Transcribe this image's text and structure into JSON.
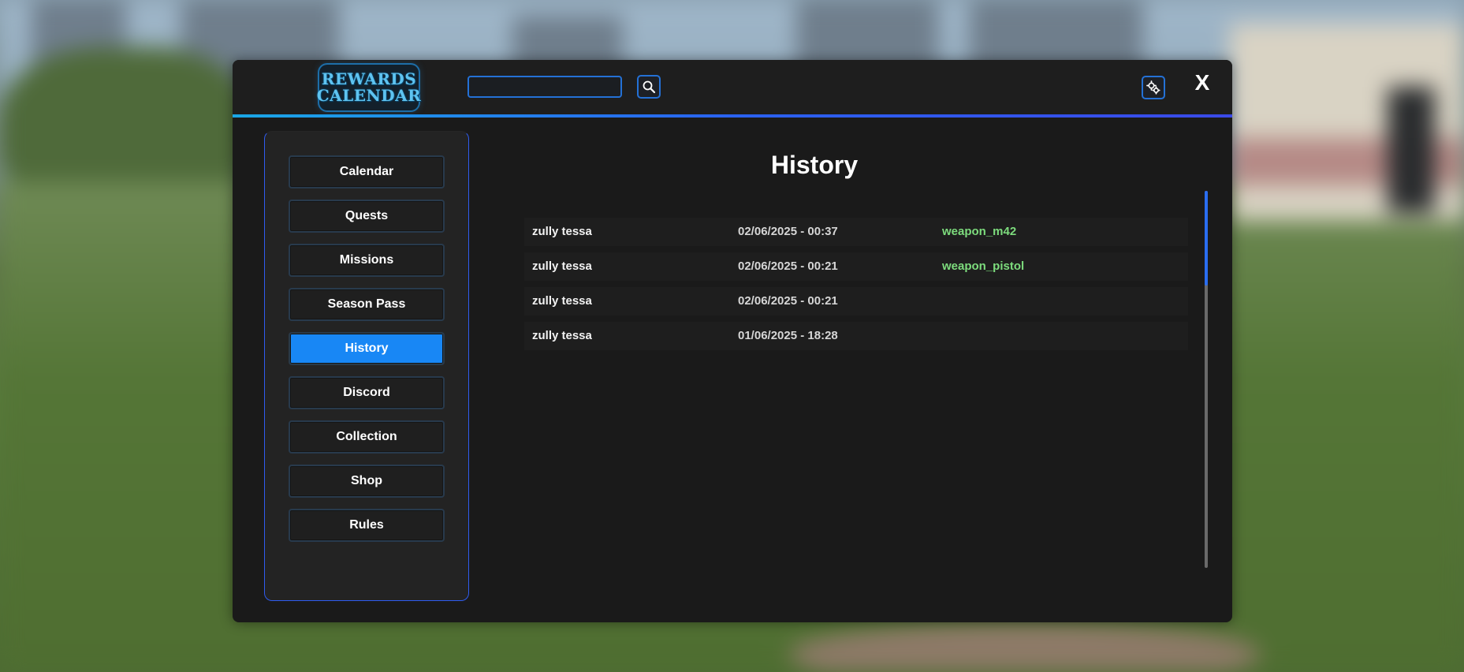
{
  "app": {
    "logo_line1": "REWARDS",
    "logo_line2": "CALENDAR"
  },
  "search": {
    "value": "",
    "placeholder": ""
  },
  "header": {
    "search_icon": "search-icon",
    "settings_icon": "gear-icon",
    "close_label": "X"
  },
  "sidebar": {
    "items": [
      {
        "label": "Calendar"
      },
      {
        "label": "Quests"
      },
      {
        "label": "Missions"
      },
      {
        "label": "Season Pass"
      },
      {
        "label": "History",
        "active": true
      },
      {
        "label": "Discord"
      },
      {
        "label": "Collection"
      },
      {
        "label": "Shop"
      },
      {
        "label": "Rules"
      }
    ]
  },
  "main": {
    "title": "History",
    "rows": [
      {
        "user": "zully tessa",
        "date": "02/06/2025 - 00:37",
        "item": "weapon_m42"
      },
      {
        "user": "zully tessa",
        "date": "02/06/2025 - 00:21",
        "item": "weapon_pistol"
      },
      {
        "user": "zully tessa",
        "date": "02/06/2025 - 00:21",
        "item": ""
      },
      {
        "user": "zully tessa",
        "date": "01/06/2025 - 18:28",
        "item": ""
      }
    ]
  },
  "colors": {
    "accent": "#1887f5",
    "border_blue": "#2471d6",
    "item_green": "#7ddc7d",
    "panel_bg": "#1a1a1a"
  }
}
